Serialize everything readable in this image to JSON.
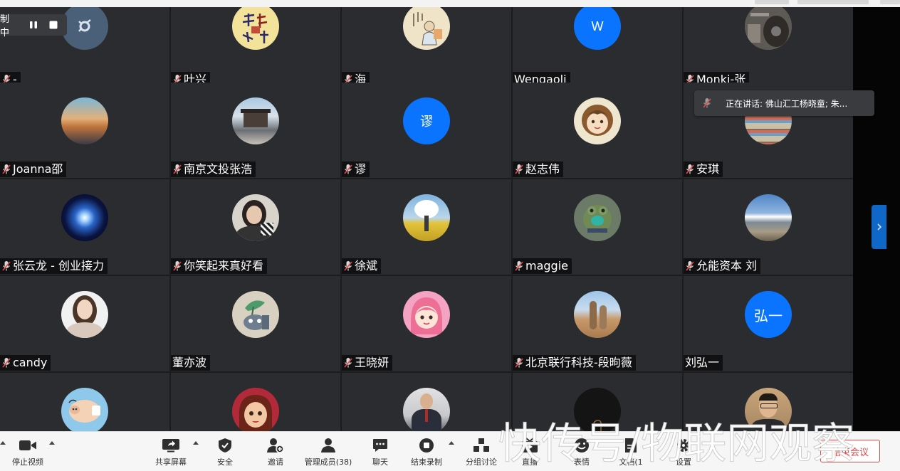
{
  "recording": {
    "label": "制中"
  },
  "speaking": {
    "text": "正在讲话: 佛山汇工杨晓童; 朱..."
  },
  "tiles": [
    {
      "name": "-",
      "mic": true,
      "avatar": "photo-gear-icon"
    },
    {
      "name": "叶兴",
      "mic": true,
      "avatar": "calligraphy-seal"
    },
    {
      "name": "海",
      "mic": true,
      "avatar": "painting-scroll"
    },
    {
      "name": "Wengaoli",
      "mic": false,
      "avatar_letter": "W",
      "avatar_color": "#0a74ff"
    },
    {
      "name": "Monki-张",
      "mic": true,
      "avatar": "photo-guitar"
    },
    {
      "name": "Joanna邵",
      "mic": true,
      "avatar": "photo-sunset-rocks"
    },
    {
      "name": "南京文投张浩",
      "mic": true,
      "avatar": "photo-gate-tower"
    },
    {
      "name": "谬",
      "mic": true,
      "avatar_letter": "谬",
      "avatar_color": "#0a74ff"
    },
    {
      "name": "赵志伟",
      "mic": true,
      "avatar": "cartoon-girl"
    },
    {
      "name": "安琪",
      "mic": true,
      "avatar": "photo-shop-shelves"
    },
    {
      "name": "张云龙 - 创业接力",
      "mic": true,
      "avatar": "photo-galaxy"
    },
    {
      "name": "你笑起来真好看",
      "mic": true,
      "avatar": "photo-woman-portrait"
    },
    {
      "name": "徐斌",
      "mic": true,
      "avatar": "photo-cloud-field"
    },
    {
      "name": "maggie",
      "mic": true,
      "avatar": "cartoon-frog"
    },
    {
      "name": "允能资本 刘",
      "mic": true,
      "avatar": "photo-mountains"
    },
    {
      "name": "candy",
      "mic": true,
      "avatar": "photo-woman-white"
    },
    {
      "name": "董亦波",
      "mic": false,
      "avatar": "cartoon-robot-plant"
    },
    {
      "name": "王晓妍",
      "mic": true,
      "avatar": "cartoon-pink-girl"
    },
    {
      "name": "北京联行科技-段昫薇",
      "mic": true,
      "avatar": "photo-meerkats"
    },
    {
      "name": "刘弘一",
      "mic": false,
      "avatar_letter": "弘一",
      "avatar_color": "#0a74ff"
    },
    {
      "name": "",
      "mic": false,
      "avatar": "cartoon-pig"
    },
    {
      "name": "",
      "mic": false,
      "avatar": "cartoon-3d-girl"
    },
    {
      "name": "",
      "mic": false,
      "avatar": "photo-man-suit"
    },
    {
      "name": "",
      "mic": false,
      "avatar": "dark-logo"
    },
    {
      "name": "",
      "mic": false,
      "avatar": "photo-man-glasses"
    }
  ],
  "toolbar": {
    "stop_video": "停止视频",
    "share_screen": "共享屏幕",
    "security": "安全",
    "invite": "邀请",
    "manage_members": "管理成员(38)",
    "chat": "聊天",
    "end_recording": "结束录制",
    "breakout": "分组讨论",
    "live": "直播",
    "reactions": "表情",
    "docs": "文档(1",
    "settings": "设置",
    "end_meeting": "结束会议"
  },
  "watermark": {
    "text": "快传号/物联网观察"
  }
}
